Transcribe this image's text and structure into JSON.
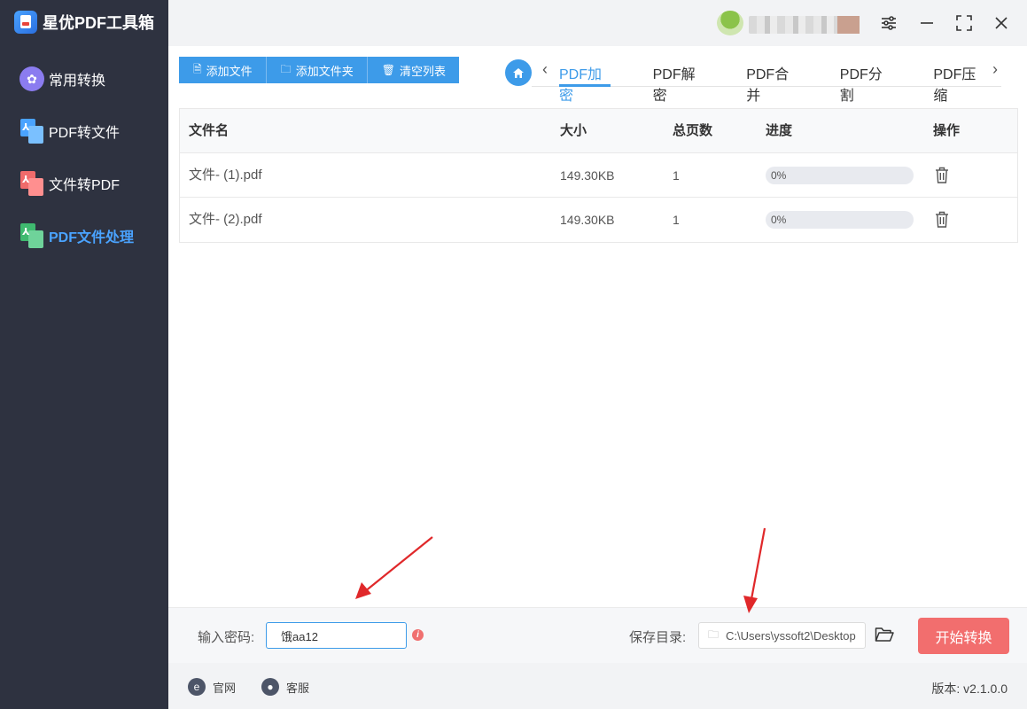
{
  "app": {
    "title": "星优PDF工具箱"
  },
  "sidebar": {
    "items": [
      {
        "label": "常用转换",
        "active": false
      },
      {
        "label": "PDF转文件",
        "active": false
      },
      {
        "label": "文件转PDF",
        "active": false
      },
      {
        "label": "PDF文件处理",
        "active": true
      }
    ]
  },
  "toolbar": {
    "add_file": "添加文件",
    "add_folder": "添加文件夹",
    "clear_list": "清空列表"
  },
  "tabs": [
    {
      "label": "PDF加密",
      "active": true
    },
    {
      "label": "PDF解密",
      "active": false
    },
    {
      "label": "PDF合并",
      "active": false
    },
    {
      "label": "PDF分割",
      "active": false
    },
    {
      "label": "PDF压缩",
      "active": false
    }
  ],
  "table": {
    "headers": {
      "name": "文件名",
      "size": "大小",
      "pages": "总页数",
      "progress": "进度",
      "op": "操作"
    },
    "rows": [
      {
        "name": "文件- (1).pdf",
        "size": "149.30KB",
        "pages": "1",
        "progress_text": "0%",
        "progress": 0
      },
      {
        "name": "文件- (2).pdf",
        "size": "149.30KB",
        "pages": "1",
        "progress_text": "0%",
        "progress": 0
      }
    ]
  },
  "footer": {
    "password_label": "输入密码:",
    "password_value": "饿aa12",
    "save_dir_label": "保存目录:",
    "save_dir_value": "C:\\Users\\yssoft2\\Desktop",
    "start_button": "开始转换"
  },
  "statusbar": {
    "website": "官网",
    "support": "客服",
    "version": "版本: v2.1.0.0"
  },
  "colors": {
    "accent": "#3d9be9",
    "sidebar": "#2e3240",
    "start": "#f26e6e",
    "annotation_arrow": "#e0282a"
  }
}
